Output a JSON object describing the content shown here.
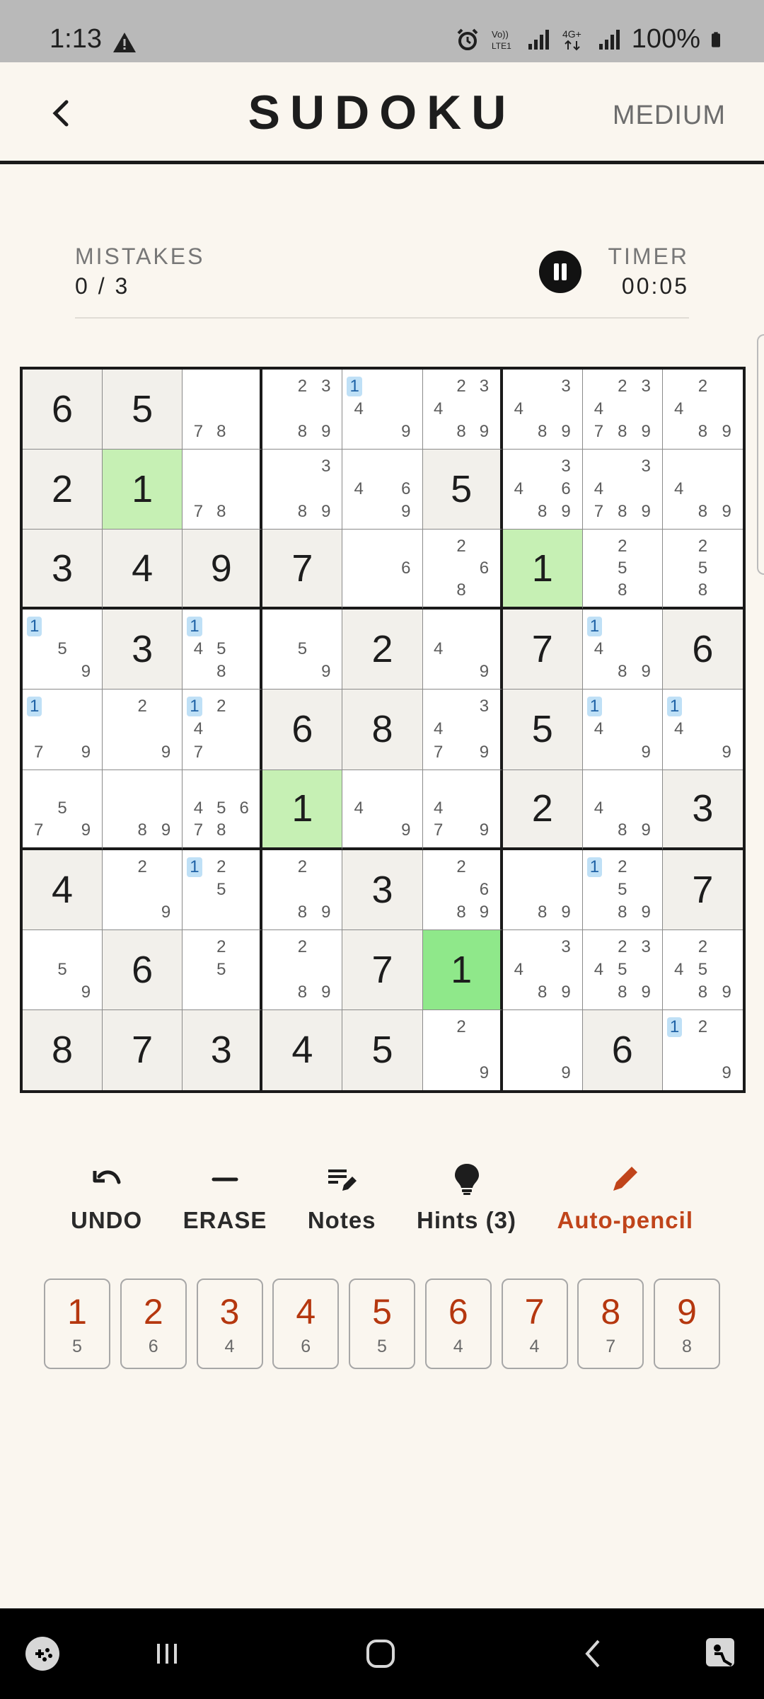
{
  "status_bar": {
    "time": "1:13",
    "network": "VoLTE LTE1 4G+",
    "battery": "100%"
  },
  "header": {
    "title": "SUDOKU",
    "difficulty": "MEDIUM"
  },
  "stats": {
    "mistakes_label": "MISTAKES",
    "mistakes_value": "0 / 3",
    "timer_label": "TIMER",
    "timer_value": "00:05"
  },
  "board": {
    "cells": [
      {
        "v": "6",
        "given": true
      },
      {
        "v": "5",
        "given": true
      },
      {
        "n": [
          7,
          8
        ]
      },
      {
        "n": [
          2,
          3,
          8,
          9
        ]
      },
      {
        "n": [
          1,
          4,
          9
        ],
        "hi": [
          1
        ]
      },
      {
        "n": [
          2,
          3,
          4,
          8,
          9
        ]
      },
      {
        "n": [
          3,
          4,
          8,
          9
        ]
      },
      {
        "n": [
          2,
          3,
          4,
          7,
          8,
          9
        ]
      },
      {
        "n": [
          2,
          4,
          8,
          9
        ]
      },
      {
        "v": "2",
        "given": true
      },
      {
        "v": "1",
        "given": true,
        "hl": "light"
      },
      {
        "n": [
          7,
          8
        ]
      },
      {
        "n": [
          3,
          8,
          9
        ]
      },
      {
        "n": [
          4,
          6,
          9
        ]
      },
      {
        "v": "5",
        "given": true
      },
      {
        "n": [
          3,
          4,
          6,
          8,
          9
        ]
      },
      {
        "n": [
          3,
          4,
          7,
          8,
          9
        ]
      },
      {
        "n": [
          4,
          8,
          9
        ]
      },
      {
        "v": "3",
        "given": true
      },
      {
        "v": "4",
        "given": true
      },
      {
        "v": "9",
        "given": true
      },
      {
        "v": "7",
        "given": true
      },
      {
        "n": [
          6
        ]
      },
      {
        "n": [
          2,
          6,
          8
        ]
      },
      {
        "v": "1",
        "given": true,
        "hl": "light"
      },
      {
        "n": [
          2,
          5,
          8
        ]
      },
      {
        "n": [
          2,
          5,
          8
        ]
      },
      {
        "n": [
          1,
          5,
          9
        ],
        "hi": [
          1
        ]
      },
      {
        "v": "3",
        "given": true
      },
      {
        "n": [
          1,
          4,
          5,
          8
        ],
        "hi": [
          1
        ]
      },
      {
        "n": [
          5,
          9
        ]
      },
      {
        "v": "2",
        "given": true
      },
      {
        "n": [
          4,
          9
        ]
      },
      {
        "v": "7",
        "given": true
      },
      {
        "n": [
          1,
          4,
          8,
          9
        ],
        "hi": [
          1
        ]
      },
      {
        "v": "6",
        "given": true
      },
      {
        "n": [
          1,
          7,
          9
        ],
        "hi": [
          1
        ]
      },
      {
        "n": [
          2,
          9
        ]
      },
      {
        "n": [
          1,
          2,
          4,
          7
        ],
        "hi": [
          1
        ]
      },
      {
        "v": "6",
        "given": true
      },
      {
        "v": "8",
        "given": true
      },
      {
        "n": [
          3,
          4,
          7,
          9
        ]
      },
      {
        "v": "5",
        "given": true
      },
      {
        "n": [
          1,
          4,
          9
        ],
        "hi": [
          1
        ]
      },
      {
        "n": [
          1,
          4,
          9
        ],
        "hi": [
          1
        ]
      },
      {
        "n": [
          5,
          7,
          9
        ]
      },
      {
        "n": [
          8,
          9
        ]
      },
      {
        "n": [
          4,
          5,
          6,
          7,
          8
        ]
      },
      {
        "v": "1",
        "given": true,
        "hl": "light"
      },
      {
        "n": [
          4,
          9
        ]
      },
      {
        "n": [
          4,
          7,
          9
        ]
      },
      {
        "v": "2",
        "given": true
      },
      {
        "n": [
          4,
          8,
          9
        ]
      },
      {
        "v": "3",
        "given": true
      },
      {
        "v": "4",
        "given": true
      },
      {
        "n": [
          2,
          9
        ]
      },
      {
        "n": [
          1,
          2,
          5
        ],
        "hi": [
          1
        ]
      },
      {
        "n": [
          2,
          8,
          9
        ]
      },
      {
        "v": "3",
        "given": true
      },
      {
        "n": [
          2,
          6,
          8,
          9
        ]
      },
      {
        "n": [
          8,
          9
        ]
      },
      {
        "n": [
          1,
          2,
          5,
          8,
          9
        ],
        "hi": [
          1
        ]
      },
      {
        "v": "7",
        "given": true
      },
      {
        "n": [
          5,
          9
        ]
      },
      {
        "v": "6",
        "given": true
      },
      {
        "n": [
          2,
          5
        ]
      },
      {
        "n": [
          2,
          8,
          9
        ]
      },
      {
        "v": "7",
        "given": true
      },
      {
        "v": "1",
        "given": false,
        "hl": "strong"
      },
      {
        "n": [
          3,
          4,
          8,
          9
        ]
      },
      {
        "n": [
          2,
          3,
          4,
          5,
          8,
          9
        ]
      },
      {
        "n": [
          2,
          4,
          5,
          8,
          9
        ]
      },
      {
        "v": "8",
        "given": true
      },
      {
        "v": "7",
        "given": true
      },
      {
        "v": "3",
        "given": true
      },
      {
        "v": "4",
        "given": true
      },
      {
        "v": "5",
        "given": true
      },
      {
        "n": [
          2,
          9
        ]
      },
      {
        "n": [
          9
        ]
      },
      {
        "v": "6",
        "given": true
      },
      {
        "n": [
          1,
          2,
          9
        ],
        "hi": [
          1
        ]
      }
    ]
  },
  "tools": [
    {
      "label": "UNDO",
      "icon": "undo-icon"
    },
    {
      "label": "ERASE",
      "icon": "erase-icon"
    },
    {
      "label": "Notes",
      "icon": "notes-icon"
    },
    {
      "label": "Hints (3)",
      "icon": "lightbulb-icon"
    },
    {
      "label": "Auto-pencil",
      "icon": "pencil-icon",
      "active": true
    }
  ],
  "numpad": [
    {
      "n": "1",
      "count": "5"
    },
    {
      "n": "2",
      "count": "6"
    },
    {
      "n": "3",
      "count": "4"
    },
    {
      "n": "4",
      "count": "6"
    },
    {
      "n": "5",
      "count": "5"
    },
    {
      "n": "6",
      "count": "4"
    },
    {
      "n": "7",
      "count": "4"
    },
    {
      "n": "8",
      "count": "7"
    },
    {
      "n": "9",
      "count": "8"
    }
  ],
  "colors": {
    "accent": "#c0441a",
    "digit_accent": "#b5370f",
    "highlight": "#c6f0b4",
    "selected": "#8fe88a",
    "note_highlight": "#bfe0f6"
  }
}
